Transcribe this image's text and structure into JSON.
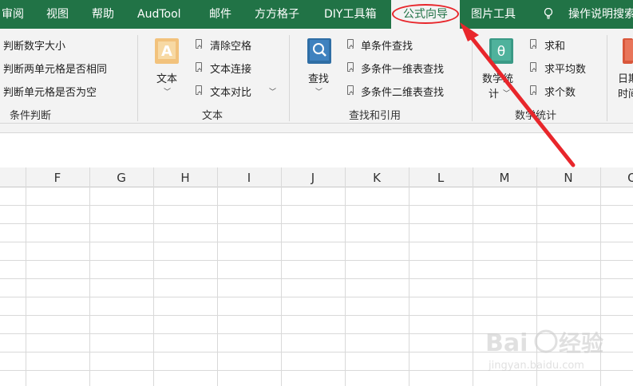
{
  "tabs": [
    "审阅",
    "视图",
    "帮助",
    "AudTool",
    "邮件",
    "方方格子",
    "DIY工具箱",
    "公式向导",
    "图片工具",
    "操作说明搜索"
  ],
  "active_tab": "公式向导",
  "ribbon": {
    "condition": {
      "items": [
        "判断数字大小",
        "判断两单元格是否相同",
        "判断单元格是否为空"
      ],
      "label": "条件判断"
    },
    "text": {
      "big_button": "文本",
      "items": [
        "清除空格",
        "文本连接",
        "文本对比"
      ],
      "label": "文本"
    },
    "lookup": {
      "big_button": "查找",
      "items": [
        "单条件查找",
        "多条件一维表查找",
        "多条件二维表查找"
      ],
      "label": "查找和引用"
    },
    "math": {
      "big_button_line1": "数学统",
      "big_button_line2": "计",
      "items": [
        "求和",
        "求平均数",
        "求个数"
      ],
      "label": "数学统计"
    },
    "date": {
      "line1": "日期",
      "line2": "时间"
    }
  },
  "columns": [
    "F",
    "G",
    "H",
    "I",
    "J",
    "K",
    "L",
    "M",
    "N",
    "O"
  ],
  "watermark": {
    "brand": "Baidu经验",
    "url": "jingyan.baidu.com"
  },
  "colors": {
    "excel_green": "#217346",
    "annotation_red": "#e8262b"
  }
}
